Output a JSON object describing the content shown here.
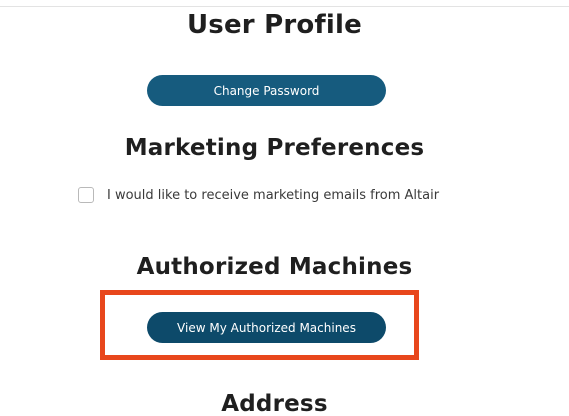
{
  "user_profile": {
    "title": "User Profile",
    "change_password_label": "Change Password"
  },
  "marketing": {
    "title": "Marketing Preferences",
    "opt_in_label": "I would like to receive marketing emails from Altair",
    "opt_in_checked": false
  },
  "authorized_machines": {
    "title": "Authorized Machines",
    "view_button_label": "View My Authorized Machines"
  },
  "address": {
    "title": "Address"
  },
  "colors": {
    "button_primary": "#165b7e",
    "button_highlighted": "#0d4a6a",
    "highlight_border": "#e8471c"
  }
}
